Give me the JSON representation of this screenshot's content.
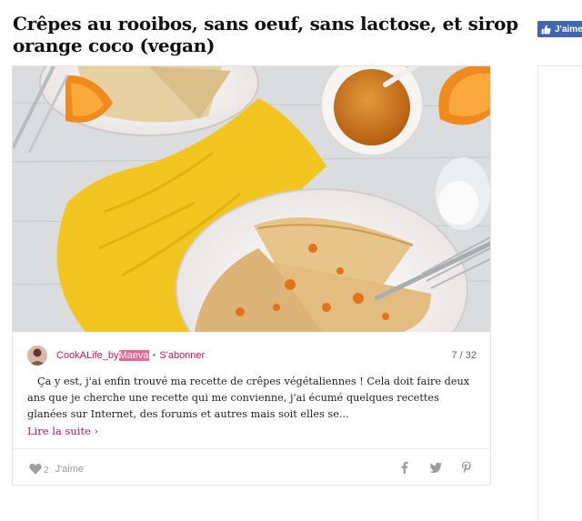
{
  "article": {
    "title": "Crêpes au rooibos, sans oeuf, sans lactose, et sirop orange coco (vegan)"
  },
  "facebook": {
    "like_label": "J'aime"
  },
  "card": {
    "author_prefix": "CookALife_by",
    "author_highlight": "Maeva",
    "separator": "•",
    "subscribe_label": "S'abonner",
    "counter": "7 / 32",
    "excerpt": "Ça y est, j'ai enfin trouvé ma recette de crêpes végétaliennes ! Cela doit faire deux ans que je cherche une recette qui me convienne, j'ai écumé quelques recettes glanées sur Internet, des forums et autres mais soit elles se...",
    "read_more": "Lire la suite ›",
    "like_count": "2",
    "like_label": "J'aime",
    "share_icons": [
      "facebook-icon",
      "twitter-icon",
      "pinterest-icon"
    ]
  },
  "colors": {
    "accent": "#c2185b",
    "highlight": "#f06292",
    "facebook": "#4267b2"
  }
}
